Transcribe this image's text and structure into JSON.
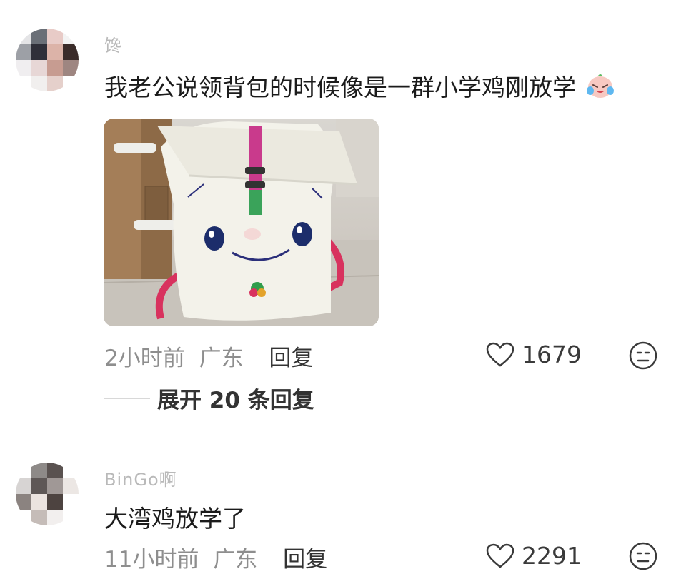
{
  "comments": [
    {
      "username": "馋",
      "text": "我老公说领背包的时候像是一群小学鸡刚放学",
      "emoji_icon": "laughing-crying-face-icon",
      "time": "2小时前",
      "location": "广东",
      "reply_label": "回复",
      "likes": "1679",
      "expand_label": "展开 20 条回复",
      "has_image": true,
      "image_description": "backpack-photo"
    },
    {
      "username": "BinGo啊",
      "text": "大湾鸡放学了",
      "time": "11小时前",
      "location": "广东",
      "reply_label": "回复",
      "likes": "2291"
    }
  ],
  "colors": {
    "meta_gray": "#8e8e8e",
    "text": "#1b1b1b",
    "strap_pink": "#d8325e",
    "backpack_white": "#f3f2ea",
    "logo_green": "#2f9d4b"
  }
}
